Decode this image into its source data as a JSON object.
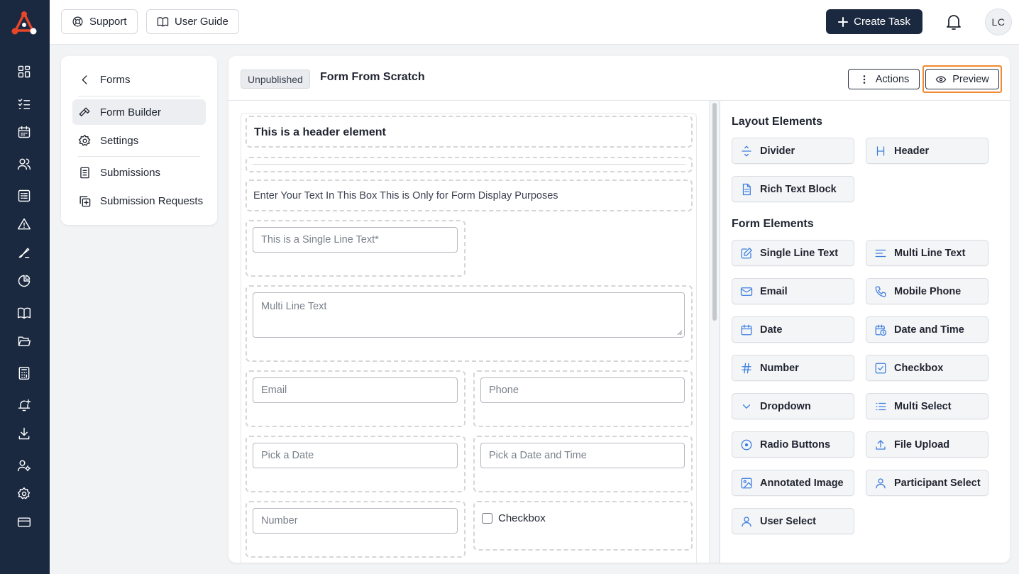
{
  "app": {
    "user_initials": "LC"
  },
  "topbar": {
    "support_label": "Support",
    "guide_label": "User Guide",
    "create_label": "Create Task"
  },
  "subnav": {
    "back_label": "Forms",
    "items": [
      {
        "label": "Form Builder",
        "active": true
      },
      {
        "label": "Settings"
      },
      {
        "label": "Submissions"
      },
      {
        "label": "Submission Requests"
      }
    ]
  },
  "form": {
    "status": "Unpublished",
    "title": "Form From Scratch",
    "actions_label": "Actions",
    "preview_label": "Preview"
  },
  "canvas": {
    "header_text": "This is a header element",
    "rich_text": "Enter Your Text In This Box This is Only for Form Display Purposes",
    "single_line_placeholder": "This is a Single Line Text*",
    "multi_line_placeholder": "Multi Line Text",
    "email_placeholder": "Email",
    "phone_placeholder": "Phone",
    "date_placeholder": "Pick a Date",
    "datetime_placeholder": "Pick a Date and Time",
    "number_placeholder": "Number",
    "checkbox_label": "Checkbox"
  },
  "palette": {
    "layout_title": "Layout Elements",
    "form_title": "Form Elements",
    "layout": [
      {
        "label": "Divider",
        "icon": "divider-icon"
      },
      {
        "label": "Header",
        "icon": "header-icon"
      },
      {
        "label": "Rich Text Block",
        "icon": "document-icon"
      }
    ],
    "form": [
      {
        "label": "Single Line Text",
        "icon": "edit-icon"
      },
      {
        "label": "Multi Line Text",
        "icon": "lines-icon"
      },
      {
        "label": "Email",
        "icon": "mail-icon"
      },
      {
        "label": "Mobile Phone",
        "icon": "phone-icon"
      },
      {
        "label": "Date",
        "icon": "calendar-icon"
      },
      {
        "label": "Date and Time",
        "icon": "calendar-clock-icon"
      },
      {
        "label": "Number",
        "icon": "hash-icon"
      },
      {
        "label": "Checkbox",
        "icon": "checkbox-icon"
      },
      {
        "label": "Dropdown",
        "icon": "chevron-down-icon"
      },
      {
        "label": "Multi Select",
        "icon": "list-icon"
      },
      {
        "label": "Radio Buttons",
        "icon": "radio-icon"
      },
      {
        "label": "File Upload",
        "icon": "upload-icon"
      },
      {
        "label": "Annotated Image",
        "icon": "image-icon"
      },
      {
        "label": "Participant Select",
        "icon": "user-icon"
      },
      {
        "label": "User Select",
        "icon": "user-icon"
      }
    ]
  },
  "colors": {
    "rail": "#1b2940",
    "accent": "#3a7de0",
    "highlight": "#f08a30"
  }
}
